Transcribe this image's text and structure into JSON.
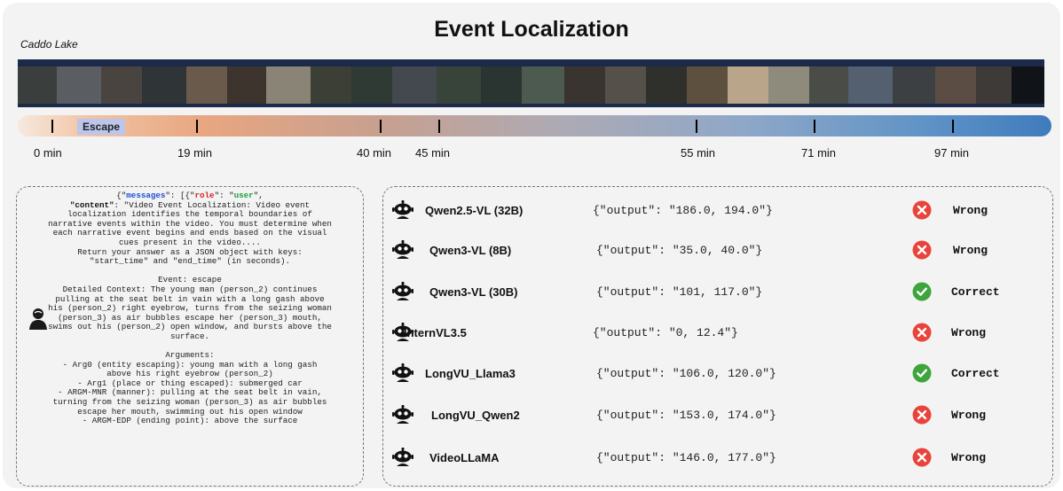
{
  "title": "Event Localization",
  "video_name": "Caddo Lake",
  "timeline": {
    "event_label": "Escape",
    "tick_labels": [
      "0 min",
      "19 min",
      "40 min",
      "45 min",
      "55 min",
      "71 min",
      "97 min"
    ]
  },
  "prompt": {
    "line1": {
      "open": "{\"",
      "messages": "messages",
      "mid1": "\": [{\"",
      "role": "role",
      "mid2": "\": \"",
      "user": "user",
      "close": "\","
    },
    "line2": {
      "content_key": "\"content\"",
      "rest": ": \"Video Event Localization: Video event"
    },
    "body_lines": [
      "localization identifies the temporal boundaries of",
      "narrative events within the video. You must determine when",
      "each narrative event begins and ends based on the visual",
      "cues present in the video....",
      "Return your answer as a JSON object with keys:",
      "\"start_time\" and \"end_time\" (in seconds)."
    ],
    "event_lines": [
      "Event: escape",
      "Detailed Context: The young man (person_2) continues",
      "pulling at the seat belt in vain with a long gash above",
      "his (person_2) right eyebrow, turns from the seizing woman",
      "(person_3) as air bubbles escape her (person_3) mouth,",
      "swims out his (person_2) open window, and bursts above the",
      "surface."
    ],
    "argument_lines": [
      "Arguments:",
      "- Arg0 (entity escaping): young man with a long gash",
      "above his right eyebrow (person_2)",
      "- Arg1 (place or thing escaped): submerged car",
      "- ARGM-MNR (manner): pulling at the seat belt in vain,",
      "turning from the seizing woman (person_3) as air bubbles",
      "escape her mouth, swimming out his open window",
      "- ARGM-EDP (ending point): above the surface"
    ]
  },
  "models": [
    {
      "name": "Qwen2.5-VL (32B)",
      "output": "{\"output\": \"186.0, 194.0\"}",
      "status": "Wrong",
      "correct": false
    },
    {
      "name": "Qwen3-VL (8B)",
      "output": "{\"output\": \"35.0, 40.0\"}",
      "status": "Wrong",
      "correct": false
    },
    {
      "name": "Qwen3-VL (30B)",
      "output": "{\"output\": \"101, 117.0\"}",
      "status": "Correct",
      "correct": true
    },
    {
      "name": "InternVL3.5",
      "output": "{\"output\": \"0, 12.4\"}",
      "status": "Wrong",
      "correct": false
    },
    {
      "name": "LongVU_Llama3",
      "output": "{\"output\": \"106.0, 120.0\"}",
      "status": "Correct",
      "correct": true
    },
    {
      "name": "LongVU_Qwen2",
      "output": "{\"output\": \"153.0, 174.0\"}",
      "status": "Wrong",
      "correct": false
    },
    {
      "name": "VideoLLaMA",
      "output": "{\"output\": \"146.0, 177.0\"}",
      "status": "Wrong",
      "correct": false
    }
  ],
  "colors": {
    "wrong": "#e8443b",
    "correct": "#3da53b",
    "json_key_blue": "#1f4fd8",
    "json_role_red": "#d42020",
    "json_user_green": "#1e9e3a"
  },
  "icons": {
    "model": "robot-icon",
    "user": "user-icon",
    "wrong": "x-circle-icon",
    "correct": "check-circle-icon"
  }
}
